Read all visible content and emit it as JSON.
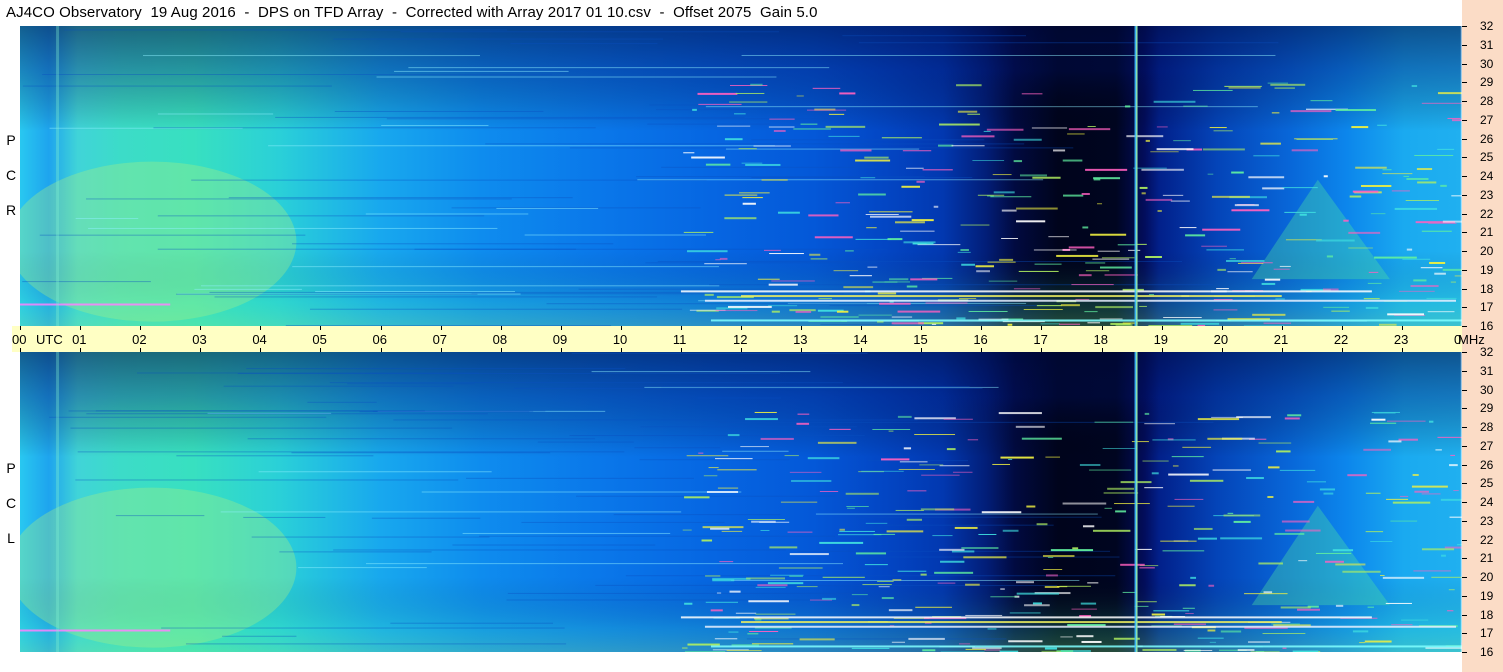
{
  "window": {
    "title": "AJ4CO Observatory  19 Aug 2016  -  DPS on TFD Array  -  Corrected with Array 2017 01 10.csv  -  Offset 2075  Gain 5.0"
  },
  "panels": {
    "top": {
      "polarization_letters": [
        "R",
        "C",
        "P"
      ]
    },
    "bottom": {
      "polarization_letters": [
        "L",
        "C",
        "P"
      ]
    }
  },
  "time_axis": {
    "labels": [
      "00",
      "01",
      "02",
      "03",
      "04",
      "05",
      "06",
      "07",
      "08",
      "09",
      "10",
      "11",
      "12",
      "13",
      "14",
      "15",
      "16",
      "17",
      "18",
      "19",
      "20",
      "21",
      "22",
      "23",
      "00"
    ],
    "utc_label": "UTC",
    "unit_label": "MHz"
  },
  "freq_axis": {
    "labels": [
      "32",
      "31",
      "30",
      "29",
      "28",
      "27",
      "26",
      "25",
      "24",
      "23",
      "22",
      "21",
      "20",
      "19",
      "18",
      "17",
      "16"
    ]
  },
  "chart_data": {
    "type": "heatmap",
    "title": "AJ4CO Observatory  19 Aug 2016  -  DPS on TFD Array  -  Corrected with Array 2017 01 10.csv  -  Offset 2075  Gain 5.0",
    "xlabel": "UTC",
    "ylabel": "MHz",
    "xlim": [
      0,
      24
    ],
    "ylim": [
      16,
      32
    ],
    "x_ticks": [
      "00",
      "01",
      "02",
      "03",
      "04",
      "05",
      "06",
      "07",
      "08",
      "09",
      "10",
      "11",
      "12",
      "13",
      "14",
      "15",
      "16",
      "17",
      "18",
      "19",
      "20",
      "21",
      "22",
      "23",
      "00"
    ],
    "y_ticks": [
      32,
      31,
      30,
      29,
      28,
      27,
      26,
      25,
      24,
      23,
      22,
      21,
      20,
      19,
      18,
      17,
      16
    ],
    "panels": [
      "RCP",
      "LCP"
    ],
    "colormap": [
      "#000010",
      "#001a8c",
      "#0050e0",
      "#0a8cf0",
      "#18c8e8",
      "#6ef0a0",
      "#e8f060",
      "#ffffff"
    ]
  }
}
